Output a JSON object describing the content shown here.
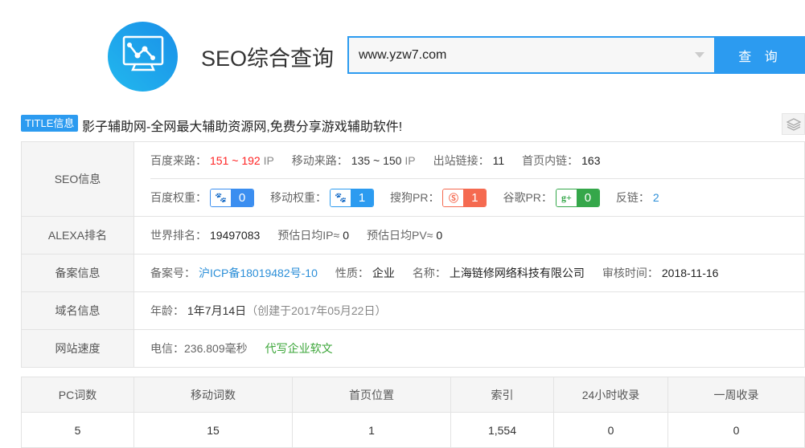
{
  "header": {
    "title": "SEO综合查询",
    "search_value": "www.yzw7.com",
    "search_button": "查 询"
  },
  "title_info": {
    "badge": "TITLE信息",
    "text": "影子辅助网-全网最大辅助资源网,免费分享游戏辅助软件!"
  },
  "seo": {
    "label": "SEO信息",
    "baidu_traffic_label": "百度来路：",
    "baidu_traffic": "151 ~ 192",
    "ip": "IP",
    "mobile_traffic_label": "移动来路：",
    "mobile_traffic": "135 ~ 150",
    "outbound_label": "出站链接：",
    "outbound": "11",
    "inlinks_label": "首页内链：",
    "inlinks": "163",
    "baidu_weight_label": "百度权重：",
    "baidu_weight": "0",
    "mobile_weight_label": "移动权重：",
    "mobile_weight": "1",
    "sogou_label": "搜狗PR：",
    "sogou": "1",
    "google_label": "谷歌PR：",
    "google": "0",
    "backlinks_label": "反链：",
    "backlinks": "2"
  },
  "alexa": {
    "label": "ALEXA排名",
    "world_label": "世界排名：",
    "world": "19497083",
    "ip_label": "预估日均IP≈",
    "ip": "0",
    "pv_label": "预估日均PV≈",
    "pv": "0"
  },
  "icp": {
    "label": "备案信息",
    "no_label": "备案号：",
    "no": "沪ICP备18019482号-10",
    "type_label": "性质：",
    "type": "企业",
    "name_label": "名称：",
    "name": "上海链修网络科技有限公司",
    "date_label": "审核时间：",
    "date": "2018-11-16"
  },
  "domain": {
    "label": "域名信息",
    "age_label": "年龄：",
    "age": "1年7月14日",
    "created": "（创建于2017年05月22日）"
  },
  "speed": {
    "label": "网站速度",
    "telecom": "电信：236.809毫秒",
    "ad": "代写企业软文"
  },
  "stats": {
    "headers": [
      "PC词数",
      "移动词数",
      "首页位置",
      "索引",
      "24小时收录",
      "一周收录"
    ],
    "values": [
      "5",
      "15",
      "1",
      "1,554",
      "0",
      "0"
    ]
  }
}
